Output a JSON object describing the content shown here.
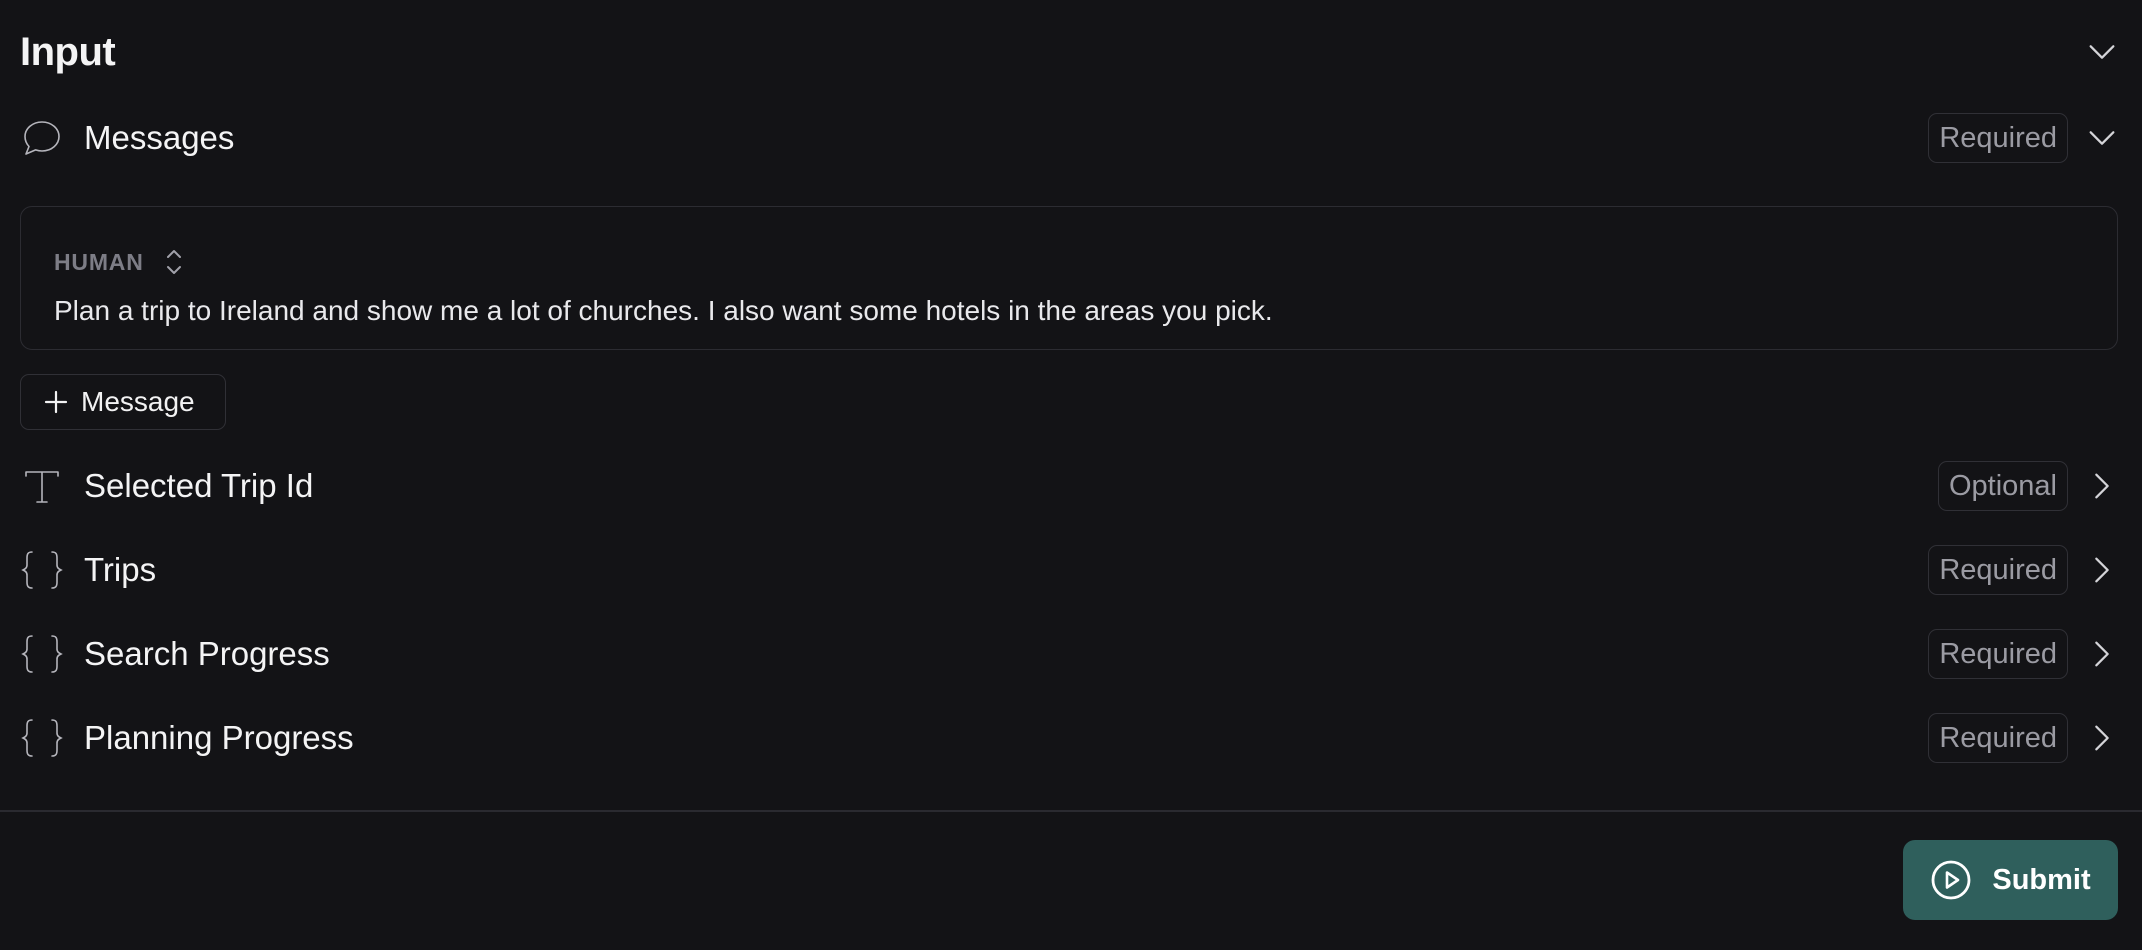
{
  "header": {
    "title": "Input"
  },
  "messages_field": {
    "label": "Messages",
    "badge": "Required",
    "icon": "chat-bubble-icon"
  },
  "message_card": {
    "role": "HUMAN",
    "text": "Plan a trip to Ireland and show me a lot of churches. I also want some hotels in the areas you pick."
  },
  "add_message": {
    "label": "Message"
  },
  "fields": [
    {
      "label": "Selected Trip Id",
      "badge": "Optional",
      "icon": "text-type-icon"
    },
    {
      "label": "Trips",
      "badge": "Required",
      "icon": "braces-icon"
    },
    {
      "label": "Search Progress",
      "badge": "Required",
      "icon": "braces-icon"
    },
    {
      "label": "Planning Progress",
      "badge": "Required",
      "icon": "braces-icon"
    }
  ],
  "submit": {
    "label": "Submit"
  },
  "colors": {
    "background": "#131316",
    "submit": "#2f5f5c",
    "badge_border": "#303036"
  }
}
